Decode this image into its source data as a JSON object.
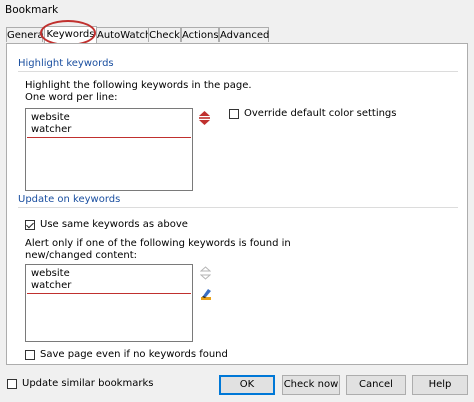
{
  "window": {
    "title": "Bookmark"
  },
  "tabs": [
    {
      "label": "General"
    },
    {
      "label": "Keywords"
    },
    {
      "label": "AutoWatch"
    },
    {
      "label": "Check"
    },
    {
      "label": "Actions"
    },
    {
      "label": "Advanced"
    }
  ],
  "active_tab": "Keywords",
  "highlight": {
    "section_title": "Highlight keywords",
    "instructions_line1": "Highlight the following keywords in the page.",
    "instructions_line2": "One word per line:",
    "keywords": [
      "website",
      "watcher"
    ],
    "override_color_label": "Override default color settings",
    "override_color_checked": false
  },
  "update": {
    "section_title": "Update on keywords",
    "use_same_label": "Use same keywords as above",
    "use_same_checked": true,
    "alert_line1": "Alert only if one of the following keywords is found in",
    "alert_line2": "new/changed content:",
    "keywords": [
      "website",
      "watcher"
    ],
    "save_page_label": "Save page even if no keywords found",
    "save_page_checked": false
  },
  "footer": {
    "update_similar_label": "Update similar bookmarks",
    "update_similar_checked": false,
    "ok_label": "OK",
    "check_now_label": "Check now",
    "cancel_label": "Cancel",
    "help_label": "Help"
  },
  "colors": {
    "accent": "#1a4fa0",
    "highlight_ring": "#c0302e"
  },
  "icons": [
    "color-picker-icon",
    "color-picker-disabled-icon",
    "highlighter-icon"
  ]
}
